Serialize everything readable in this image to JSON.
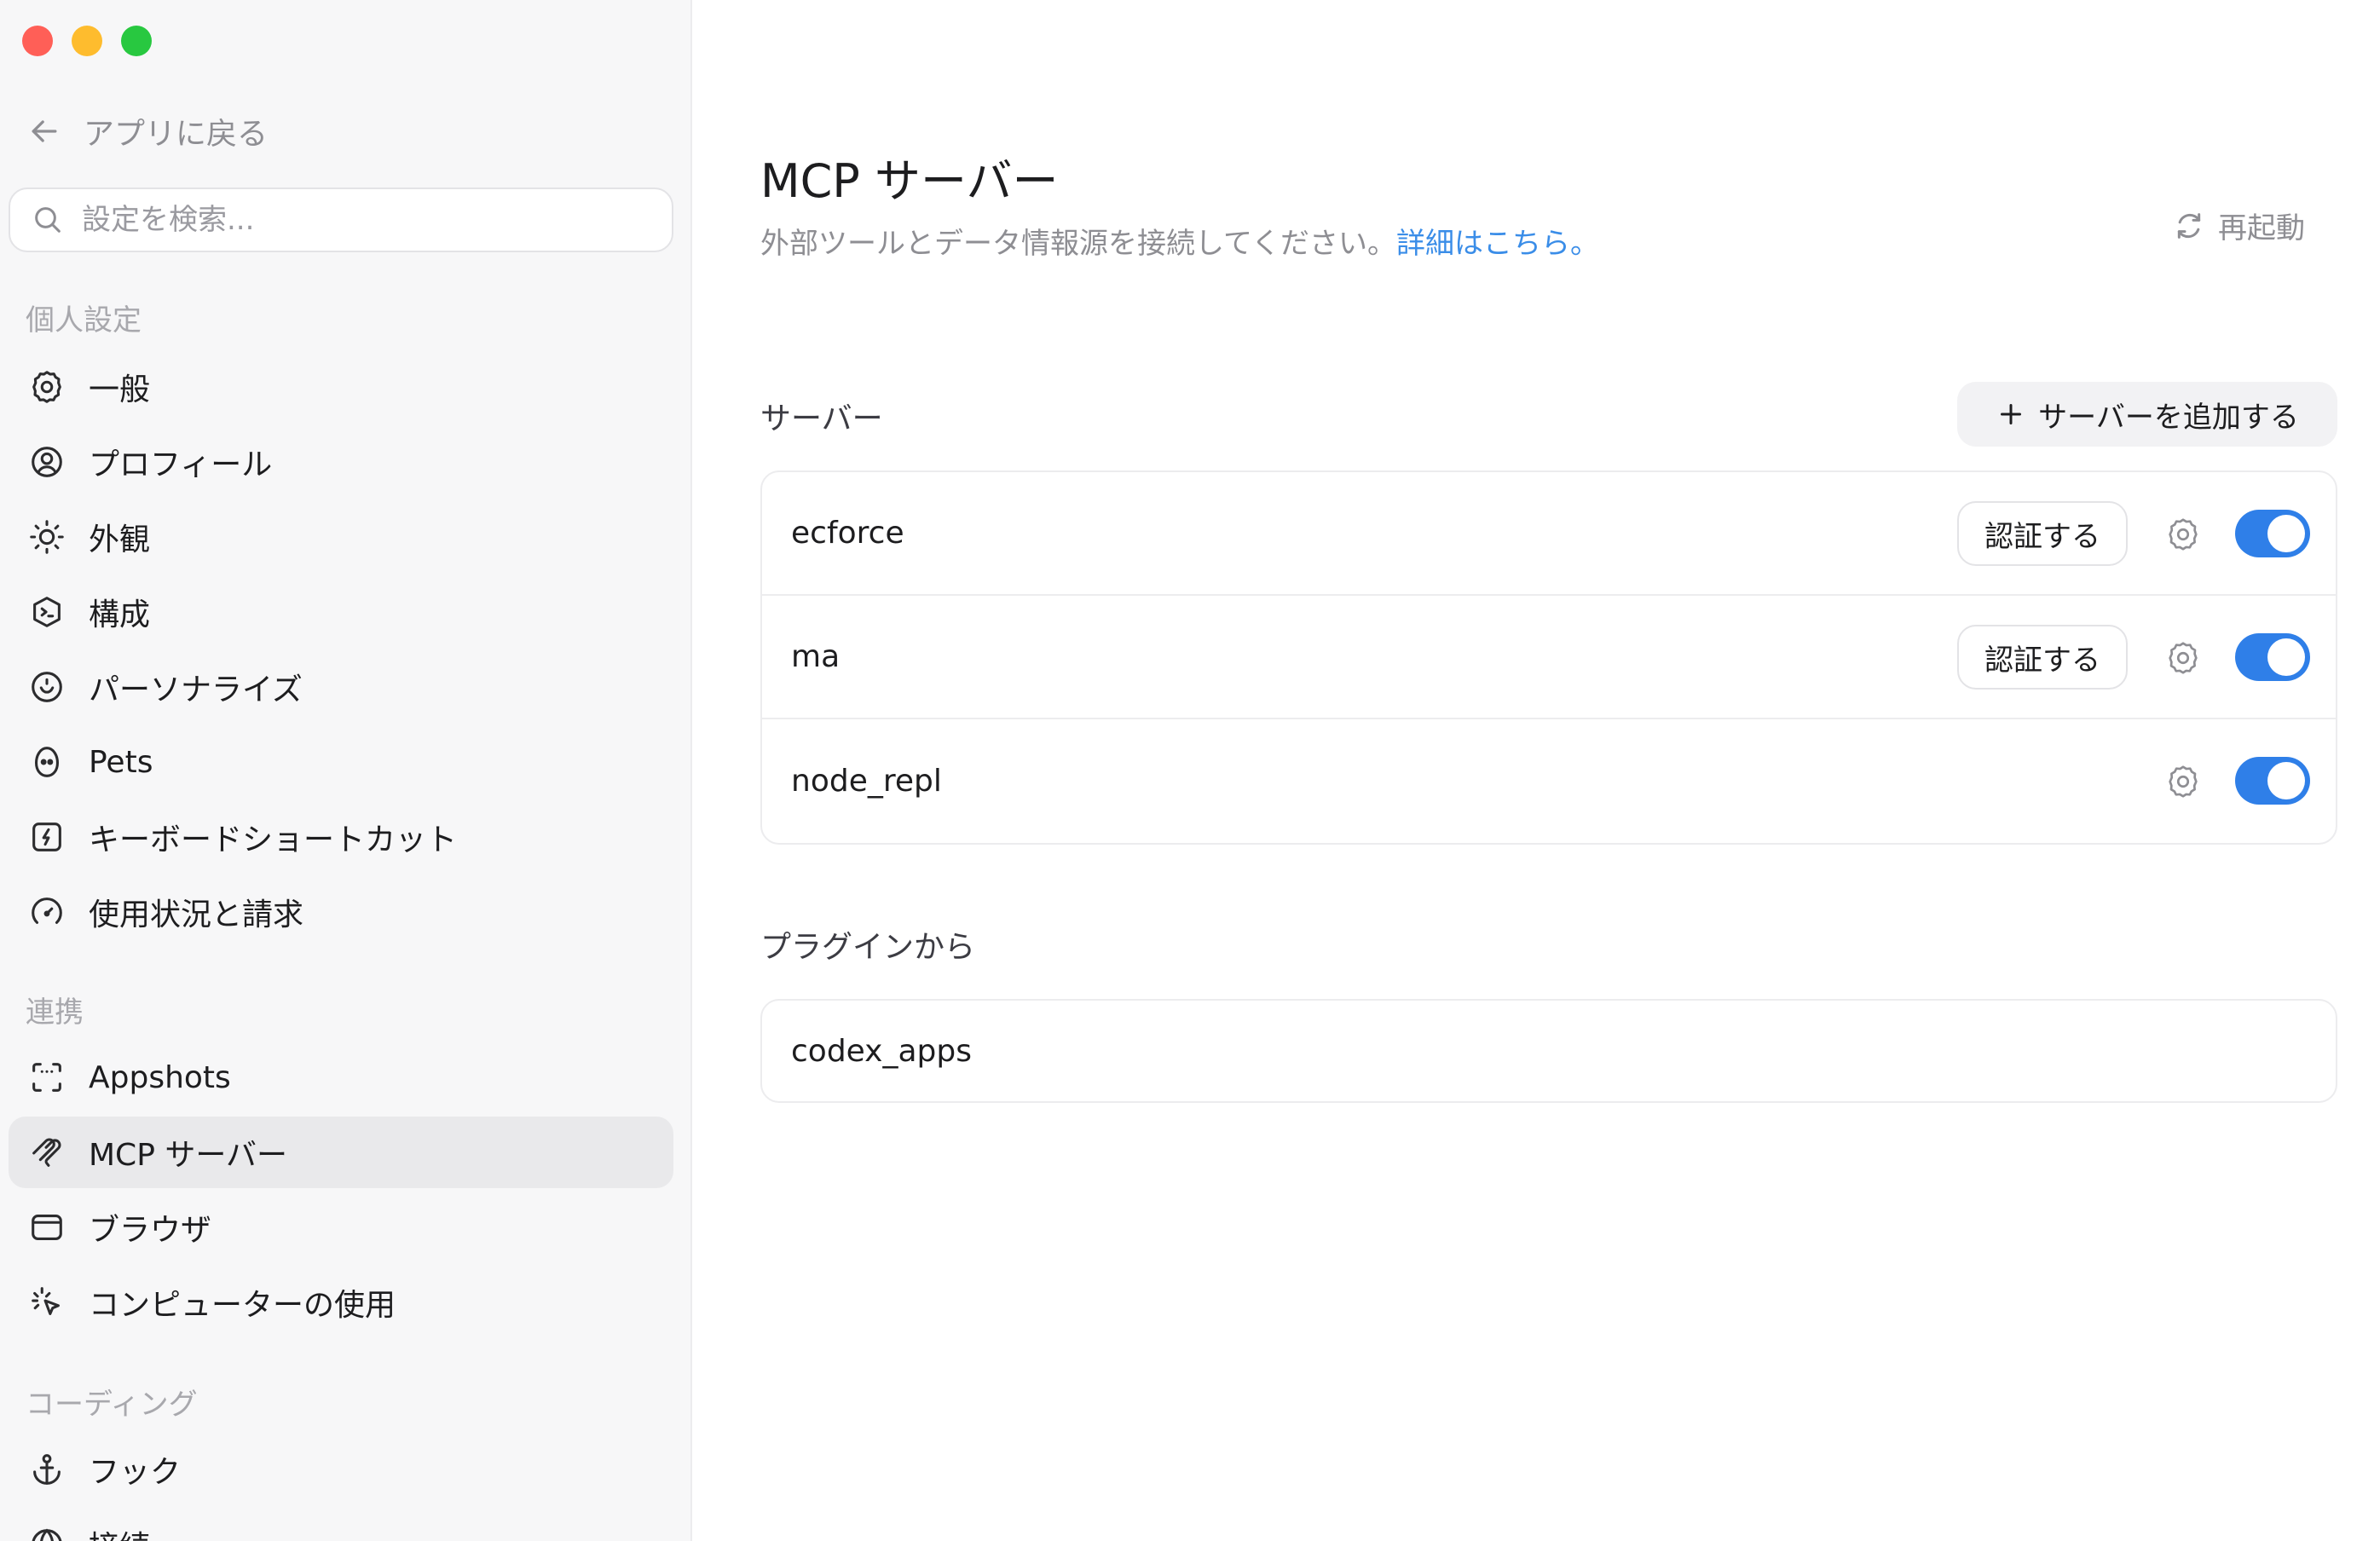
{
  "sidebar": {
    "back_label": "アプリに戻る",
    "search_placeholder": "設定を検索...",
    "sections": {
      "personal": "個人設定",
      "integrations": "連携",
      "coding": "コーディング"
    },
    "personal_items": [
      {
        "label": "一般",
        "icon": "gear-icon"
      },
      {
        "label": "プロフィール",
        "icon": "profile-icon"
      },
      {
        "label": "外観",
        "icon": "sun-icon"
      },
      {
        "label": "構成",
        "icon": "config-icon"
      },
      {
        "label": "パーソナライズ",
        "icon": "personalize-icon"
      },
      {
        "label": "Pets",
        "icon": "pet-icon"
      },
      {
        "label": "キーボードショートカット",
        "icon": "keyboard-icon"
      },
      {
        "label": "使用状況と請求",
        "icon": "gauge-icon"
      }
    ],
    "integration_items": [
      {
        "label": "Appshots",
        "icon": "appshots-icon"
      },
      {
        "label": "MCP サーバー",
        "icon": "mcp-icon",
        "active": true
      },
      {
        "label": "ブラウザ",
        "icon": "browser-icon"
      },
      {
        "label": "コンピューターの使用",
        "icon": "cursor-click-icon"
      }
    ],
    "coding_items": [
      {
        "label": "フック",
        "icon": "anchor-icon"
      },
      {
        "label": "接続",
        "icon": "globe-icon"
      }
    ]
  },
  "main": {
    "title": "MCP サーバー",
    "description": "外部ツールとデータ情報源を接続してください。",
    "learn_more": "詳細はこちら。",
    "restart_label": "再起動",
    "servers_heading": "サーバー",
    "add_server_label": "サーバーを追加する",
    "servers": [
      {
        "name": "ecforce",
        "auth_label": "認証する",
        "enabled": true
      },
      {
        "name": "ma",
        "auth_label": "認証する",
        "enabled": true
      },
      {
        "name": "node_repl",
        "enabled": true
      }
    ],
    "plugins_heading": "プラグインから",
    "plugins": [
      {
        "name": "codex_apps"
      }
    ]
  },
  "colors": {
    "accent": "#2f7fe8",
    "link": "#3a8de8",
    "sidebar_bg": "#f7f7f8"
  }
}
